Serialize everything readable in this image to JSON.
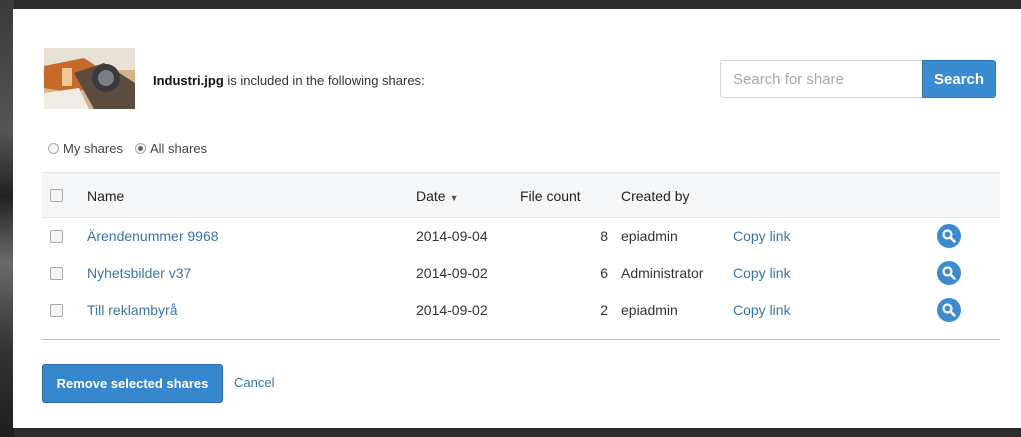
{
  "dialog": {
    "file_name": "Industri.jpg",
    "intro_text": " is included in the following shares:"
  },
  "search": {
    "placeholder": "Search for share",
    "button_label": "Search"
  },
  "filters": [
    {
      "label": "My shares",
      "checked": false
    },
    {
      "label": "All shares",
      "checked": true
    }
  ],
  "table": {
    "columns": {
      "name": "Name",
      "date": "Date",
      "file_count": "File count",
      "created_by": "Created by"
    },
    "sort_indicator": "▼",
    "rows": [
      {
        "name": "Ärendenummer 9968",
        "date": "2014-09-04",
        "file_count": "8",
        "created_by": "epiadmin",
        "link_label": "Copy link"
      },
      {
        "name": "Nyhetsbilder v37",
        "date": "2014-09-02",
        "file_count": "6",
        "created_by": "Administrator",
        "link_label": "Copy link"
      },
      {
        "name": "Till reklambyrå",
        "date": "2014-09-02",
        "file_count": "2",
        "created_by": "epiadmin",
        "link_label": "Copy link"
      }
    ]
  },
  "footer": {
    "remove_label": "Remove selected shares",
    "cancel_label": "Cancel"
  },
  "colors": {
    "accent": "#3b8bd1",
    "link": "#3a74a9"
  },
  "icons": {
    "view": "search-icon"
  }
}
